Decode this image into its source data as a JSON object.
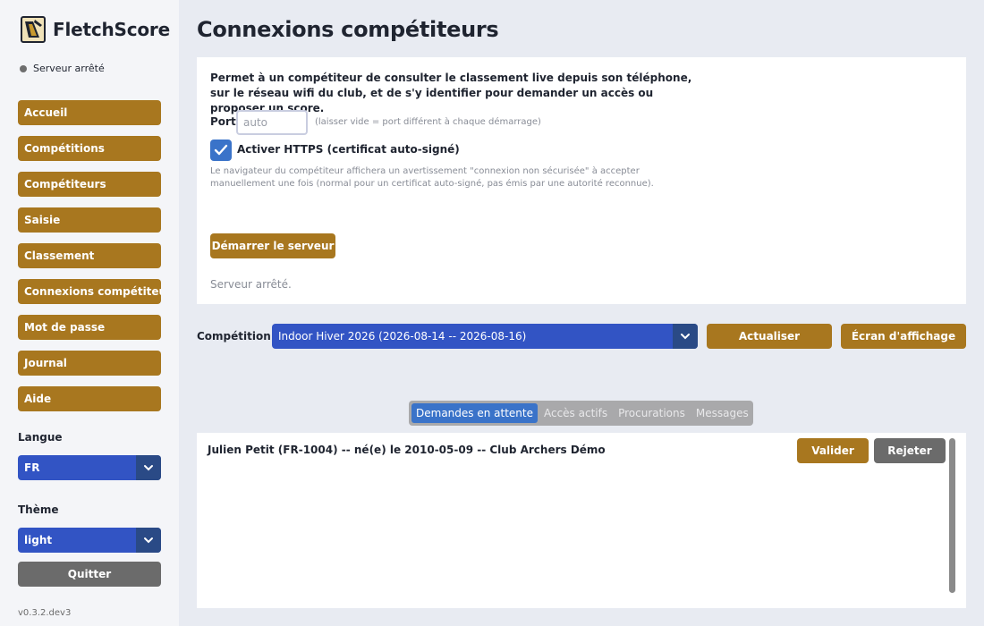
{
  "app": {
    "title": "FletchScore",
    "version": "v0.3.2.dev3"
  },
  "sidebar": {
    "status": "Serveur arrêté",
    "nav": [
      "Accueil",
      "Compétitions",
      "Compétiteurs",
      "Saisie",
      "Classement",
      "Connexions compétiteurs",
      "Mot de passe",
      "Journal",
      "Aide"
    ],
    "language_label": "Langue",
    "language_value": "FR",
    "theme_label": "Thème",
    "theme_value": "light",
    "quit_label": "Quitter"
  },
  "main": {
    "title": "Connexions compétiteurs",
    "description": "Permet à un compétiteur de consulter le classement live depuis son téléphone, sur le réseau wifi du club, et de s'y identifier pour demander un accès ou proposer un score.",
    "port_label": "Port",
    "port_placeholder": "auto",
    "port_value": "",
    "port_hint": "(laisser vide = port différent à chaque démarrage)",
    "https_label": "Activer HTTPS (certificat auto-signé)",
    "https_checked": true,
    "https_warning": "Le navigateur du compétiteur affichera un avertissement \"connexion non sécurisée\" à accepter manuellement une fois (normal pour un certificat auto-signé, pas émis par une autorité reconnue).",
    "start_button": "Démarrer le serveur",
    "server_status": "Serveur arrêté.",
    "competition_label": "Compétition :",
    "competition_value": "Indoor Hiver 2026 (2026-08-14 -- 2026-08-16)",
    "refresh_button": "Actualiser",
    "display_button": "Écran d'affichage",
    "tabs": [
      "Demandes en attente",
      "Accès actifs",
      "Procurations",
      "Messages"
    ],
    "requests": [
      {
        "text": "Julien Petit (FR-1004) -- né(e) le 2010-05-09 -- Club Archers Démo",
        "validate": "Valider",
        "reject": "Rejeter"
      }
    ]
  },
  "colors": {
    "accent_gold": "#a8771f",
    "select_blue": "#3254c4",
    "tab_active_blue": "#3a73c9",
    "neutral_gray": "#6b6b6b"
  }
}
